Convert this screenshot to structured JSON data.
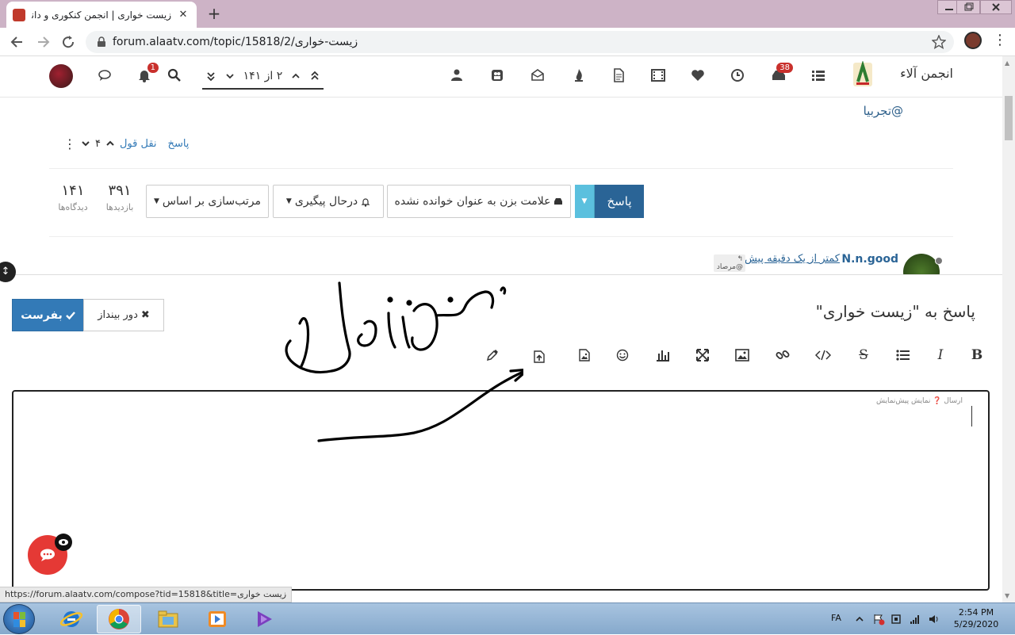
{
  "browser": {
    "tab_title": "زیست خواری | انجمن کنکوری و دانش آموزی آلاء",
    "url": "forum.alaatv.com/topic/15818/2/زیست-خواری",
    "status_url": "https://forum.alaatv.com/compose?tid=15818&title=زیست خواری"
  },
  "header": {
    "brand": "انجمن آلاء",
    "chat_badge": "38",
    "notification_badge": "1",
    "pager_text": "۲ از ۱۴۱"
  },
  "post": {
    "mention": "@تجربیا",
    "reply_link": "پاسخ",
    "quote_link": "نقل قول",
    "vote_count": "۴"
  },
  "topic_tools": {
    "reply_label": "پاسخ",
    "mark_unread_label": "علامت بزن به عنوان خوانده نشده",
    "watching_label": "درحال پیگیری",
    "sort_label": "مرتب‌سازی بر اساس"
  },
  "stats": {
    "views_value": "۳۹۱",
    "views_label": "بازدیدها",
    "posts_value": "۱۴۱",
    "posts_label": "دیدگاه‌ها"
  },
  "latest_post": {
    "username": "N.n.good",
    "time_ago": "کمتر از یک دقیقه پیش",
    "reply_tag": "@مرصاد"
  },
  "composer": {
    "title": "پاسخ به \"زیست خواری\"",
    "submit_label": "بفرست",
    "discard_label": "دور بینداز",
    "preview_hint": "ارسال ❓ نمایش پیش‌نمایش",
    "toolbar_icons": [
      "bold-icon",
      "italic-icon",
      "list-icon",
      "strikethrough-icon",
      "code-icon",
      "link-icon",
      "picture-icon",
      "fullscreen-icon",
      "chart-icon",
      "emoji-icon",
      "image-upload-icon",
      "file-upload-icon",
      "color-picker-icon"
    ]
  },
  "annotation": {
    "handwriting": "بزن رواین"
  },
  "taskbar": {
    "language": "FA",
    "time": "2:54 PM",
    "date": "5/29/2020"
  },
  "colors": {
    "tabstrip": "#cdb3c6",
    "primary": "#337ab7",
    "reply": "#2a6496",
    "accent_info": "#5bc0de",
    "badge": "#c9302c",
    "fab": "#e53935"
  }
}
